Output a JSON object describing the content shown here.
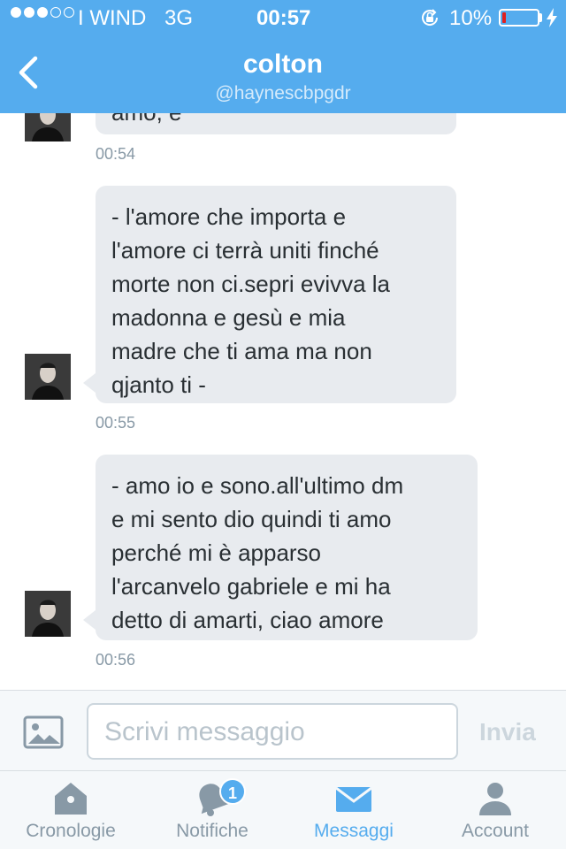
{
  "status_bar": {
    "signal_bars": 5,
    "signal_filled": 3,
    "carrier": "I WIND",
    "network": "3G",
    "time": "00:57",
    "battery_text": "10%",
    "battery_level": 0.1
  },
  "header": {
    "title": "colton",
    "handle": "@haynescbpgdr",
    "back_icon": "chevron-left-icon"
  },
  "messages": [
    {
      "text": "amo, e",
      "time": "00:54"
    },
    {
      "text": "- l'amore che importa e l'amore ci terrà uniti finché morte non ci.sepri evivva la madonna e gesù e mia madre che ti ama ma non qjanto ti -",
      "lines": [
        "- l'amore che importa e",
        "l'amore ci terrà uniti finché",
        "morte non ci.sepri evivva la",
        "madonna e gesù e mia",
        "madre che ti ama ma non",
        "qjanto ti -"
      ],
      "time": "00:55"
    },
    {
      "text": "- amo io e sono.all'ultimo dm e mi sento dio quindi ti amo perché mi è apparso l'arcanvelo gabriele e mi ha detto di amarti, ciao amore",
      "lines": [
        "- amo io e sono.all'ultimo dm",
        "e mi sento dio quindi ti amo",
        "perché mi è apparso",
        "l'arcanvelo gabriele e mi ha",
        "detto di amarti, ciao amore"
      ],
      "time": "00:56"
    }
  ],
  "composer": {
    "placeholder": "Scrivi messaggio",
    "send_label": "Invia",
    "photo_icon": "photo-icon"
  },
  "tabs": [
    {
      "label": "Cronologie",
      "icon": "home-icon",
      "active": false
    },
    {
      "label": "Notifiche",
      "icon": "bell-icon",
      "active": false,
      "badge": "1"
    },
    {
      "label": "Messaggi",
      "icon": "envelope-icon",
      "active": true
    },
    {
      "label": "Account",
      "icon": "person-icon",
      "active": false
    }
  ],
  "colors": {
    "brand": "#55acee",
    "bubble": "#e8ebef",
    "muted": "#8899a6",
    "battery_low": "#e02020"
  }
}
